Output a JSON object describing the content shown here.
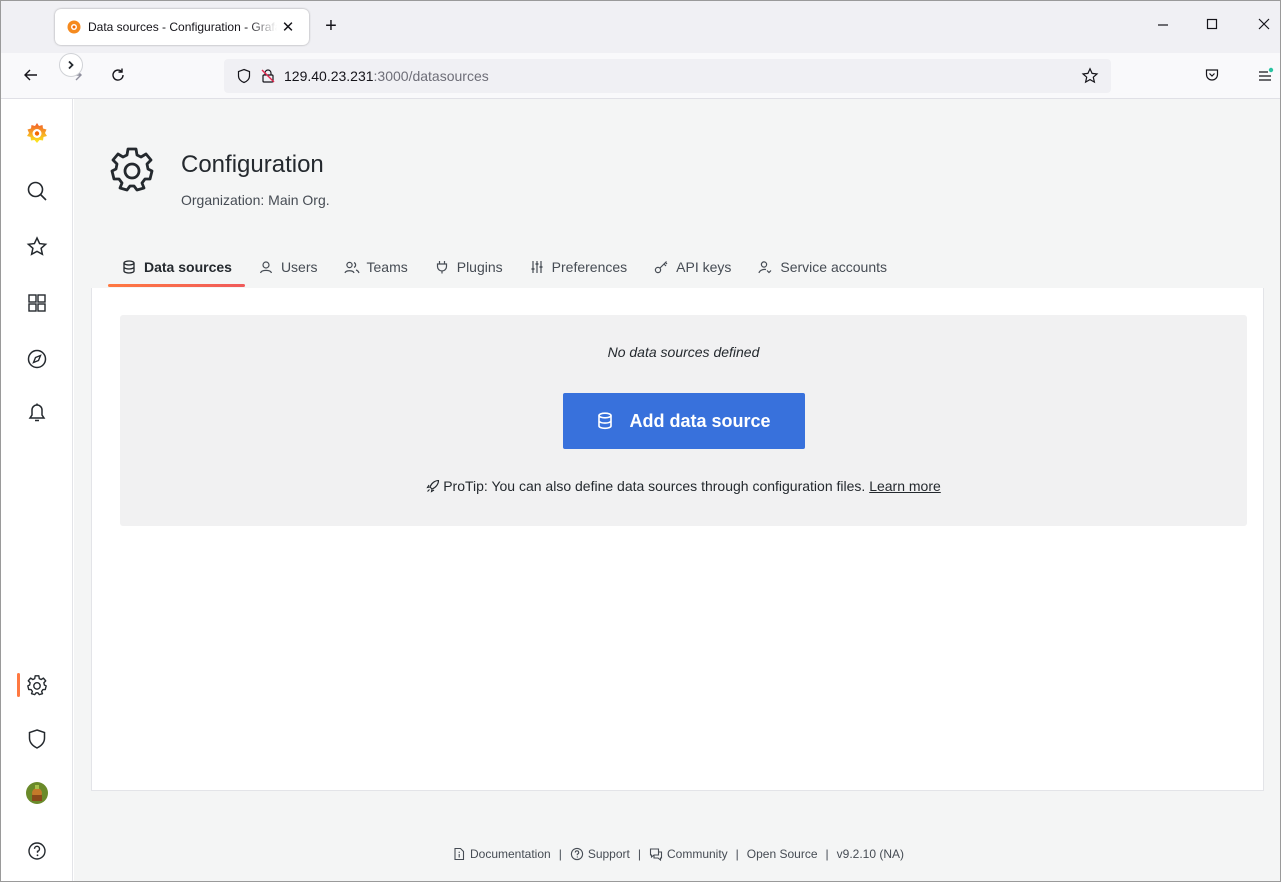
{
  "browser": {
    "tab_title": "Data sources - Configuration - Grafana",
    "tab_close": "✕",
    "new_tab": "+",
    "url_host": "129.40.23.231",
    "url_rest": ":3000/datasources",
    "window_controls": {
      "minimize": "—",
      "maximize": "☐",
      "close": "✕"
    }
  },
  "header": {
    "title": "Configuration",
    "subtitle": "Organization: Main Org."
  },
  "tabs": [
    {
      "label": "Data sources",
      "icon": "database-icon",
      "active": true
    },
    {
      "label": "Users",
      "icon": "user-icon"
    },
    {
      "label": "Teams",
      "icon": "users-icon"
    },
    {
      "label": "Plugins",
      "icon": "plug-icon"
    },
    {
      "label": "Preferences",
      "icon": "sliders-icon"
    },
    {
      "label": "API keys",
      "icon": "key-icon"
    },
    {
      "label": "Service accounts",
      "icon": "user-arrows-icon"
    }
  ],
  "empty_state": {
    "title": "No data sources defined",
    "button_label": "Add data source",
    "protip": "ProTip: You can also define data sources through configuration files.",
    "learn_more": "Learn more"
  },
  "footer": {
    "documentation": "Documentation",
    "support": "Support",
    "community": "Community",
    "open_source": "Open Source",
    "version": "v9.2.10 (NA)",
    "separator": "|"
  },
  "colors": {
    "accent": "#ff7941",
    "primary_button": "#3871dc"
  }
}
